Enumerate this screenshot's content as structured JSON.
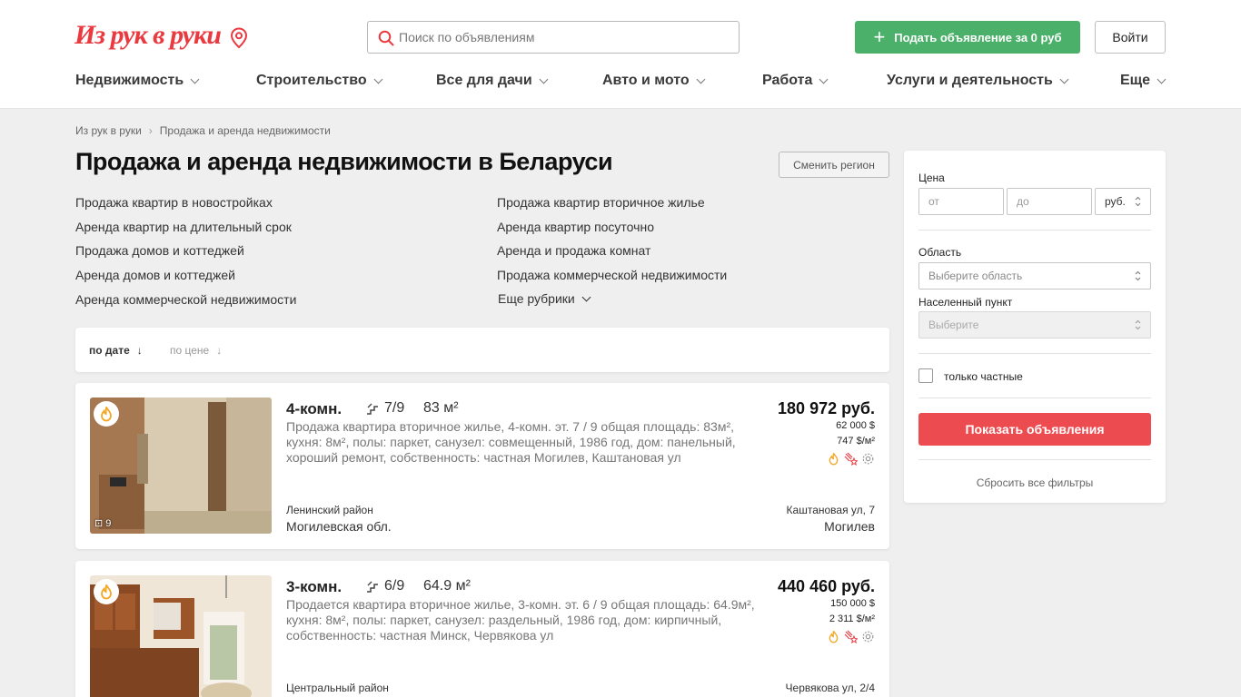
{
  "header": {
    "logo": "Из рук в руки",
    "search_placeholder": "Поиск по объявлениям",
    "post_button": "Подать объявление за 0 руб",
    "login_button": "Войти",
    "nav": [
      "Недвижимость",
      "Строительство",
      "Все для дачи",
      "Авто и мото",
      "Работа",
      "Услуги и деятельность",
      "Еще"
    ]
  },
  "breadcrumbs": [
    "Из рук в руки",
    "Продажа и аренда недвижимости"
  ],
  "page_title": "Продажа и аренда недвижимости в Беларуси",
  "region_button": "Сменить регион",
  "rubrics": {
    "left": [
      "Продажа квартир в новостройках",
      "Аренда квартир на длительный срок",
      "Продажа домов и коттеджей",
      "Аренда домов и коттеджей",
      "Аренда коммерческой недвижимости"
    ],
    "right": [
      "Продажа квартир вторичное жилье",
      "Аренда квартир посуточно",
      "Аренда и продажа комнат",
      "Продажа коммерческой недвижимости"
    ],
    "more": "Еще рубрики"
  },
  "sort": {
    "by_date": "по дате",
    "by_price": "по цене"
  },
  "listings": [
    {
      "rooms": "4-комн.",
      "floor": "7/9",
      "area": "83 м²",
      "description": "Продажа квартира вторичное жилье, 4-комн. эт. 7 / 9 общая площадь: 83м², кухня: 8м², полы: паркет, санузел: совмещенный, 1986 год, дом: панельный, хороший ремонт, собственность: частная Могилев, Каштановая ул",
      "price": "180 972 руб.",
      "price_usd": "62 000 $",
      "price_per_m": "747 $/м²",
      "photo_count": "9",
      "district": "Ленинский район",
      "oblast": "Могилевская обл.",
      "street": "Каштановая ул, 7",
      "city": "Могилев"
    },
    {
      "rooms": "3-комн.",
      "floor": "6/9",
      "area": "64.9 м²",
      "description": "Продается квартира вторичное жилье, 3-комн. эт. 6 / 9 общая площадь: 64.9м², кухня: 8м², полы: паркет, санузел: раздельный, 1986 год, дом: кирпичный, собственность: частная Минск, Червякова ул",
      "price": "440 460 руб.",
      "price_usd": "150 000 $",
      "price_per_m": "2 311 $/м²",
      "district": "Центральный район",
      "street": "Червякова ул, 2/4"
    }
  ],
  "filter": {
    "price_label": "Цена",
    "from_placeholder": "от",
    "to_placeholder": "до",
    "currency": "руб.",
    "region_label": "Область",
    "region_placeholder": "Выберите область",
    "city_label": "Населенный пункт",
    "city_placeholder": "Выберите",
    "private_only": "только частные",
    "show_button": "Показать объявления",
    "reset": "Сбросить все фильтры"
  },
  "colors": {
    "brand_red": "#ea3a40",
    "green": "#4bb06a",
    "button_red": "#ec4b50"
  }
}
